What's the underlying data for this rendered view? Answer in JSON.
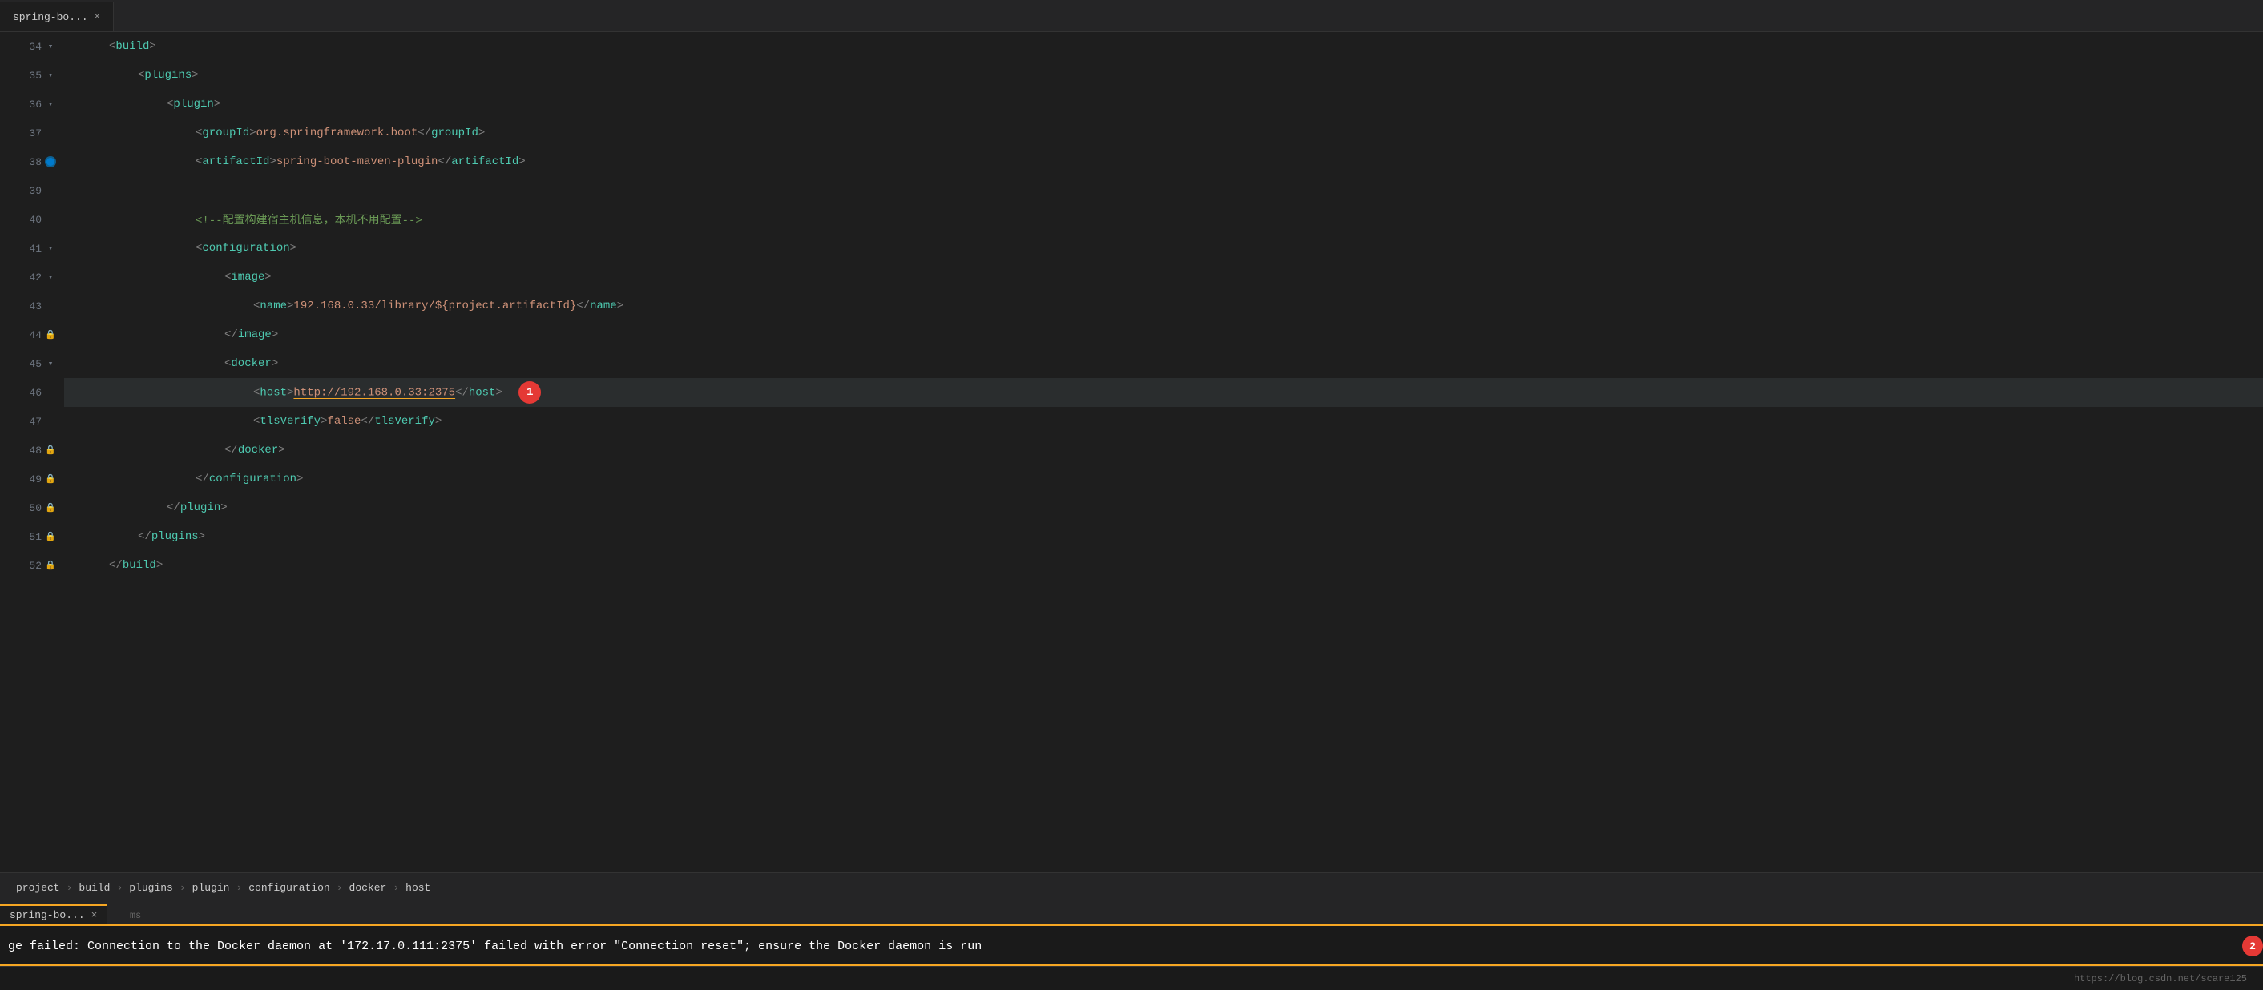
{
  "editor": {
    "title": "spring-bo...",
    "lines": [
      {
        "num": 34,
        "indent": 2,
        "hasFold": true,
        "content": "<build>",
        "type": "tag-line"
      },
      {
        "num": 35,
        "indent": 4,
        "hasFold": true,
        "content": "<plugins>",
        "type": "tag-line"
      },
      {
        "num": 36,
        "indent": 6,
        "hasFold": true,
        "content": "<plugin>",
        "type": "tag-line"
      },
      {
        "num": 37,
        "indent": 8,
        "hasFold": false,
        "content": "<groupId>org.springframework.boot</groupId>",
        "type": "tag-content"
      },
      {
        "num": 38,
        "indent": 8,
        "hasFold": false,
        "content": "<artifactId>spring-boot-maven-plugin</artifactId>",
        "type": "tag-content",
        "hasDebug": true
      },
      {
        "num": 39,
        "indent": 0,
        "hasFold": false,
        "content": "",
        "type": "empty"
      },
      {
        "num": 40,
        "indent": 8,
        "hasFold": false,
        "content": "<!--配置构建宿主机信息，本机不用配置-->",
        "type": "comment"
      },
      {
        "num": 41,
        "indent": 8,
        "hasFold": true,
        "content": "<configuration>",
        "type": "tag-line"
      },
      {
        "num": 42,
        "indent": 10,
        "hasFold": true,
        "content": "<image>",
        "type": "tag-line"
      },
      {
        "num": 43,
        "indent": 12,
        "hasFold": false,
        "content": "<name>192.168.0.33/library/${project.artifactId}</name>",
        "type": "tag-content"
      },
      {
        "num": 44,
        "indent": 10,
        "hasFold": false,
        "content": "</image>",
        "type": "close-tag"
      },
      {
        "num": 45,
        "indent": 10,
        "hasFold": true,
        "content": "<docker>",
        "type": "tag-line"
      },
      {
        "num": 46,
        "indent": 12,
        "hasFold": false,
        "content": "<host>http://192.168.0.33:2375</host>",
        "type": "tag-content",
        "highlight": true,
        "annotation": "1"
      },
      {
        "num": 47,
        "indent": 12,
        "hasFold": false,
        "content": "<tlsVerify>false</tlsVerify>",
        "type": "tag-content"
      },
      {
        "num": 48,
        "indent": 10,
        "hasFold": false,
        "content": "</docker>",
        "type": "close-tag"
      },
      {
        "num": 49,
        "indent": 8,
        "hasFold": false,
        "content": "</configuration>",
        "type": "close-tag"
      },
      {
        "num": 50,
        "indent": 6,
        "hasFold": false,
        "content": "</plugin>",
        "type": "close-tag"
      },
      {
        "num": 51,
        "indent": 4,
        "hasFold": false,
        "content": "</plugins>",
        "type": "close-tag"
      },
      {
        "num": 52,
        "indent": 2,
        "hasFold": false,
        "content": "</build>",
        "type": "close-tag",
        "partial": true
      }
    ]
  },
  "breadcrumb": {
    "items": [
      "project",
      "build",
      "plugins",
      "plugin",
      "configuration",
      "docker",
      "host"
    ]
  },
  "tab": {
    "label": "spring-bo...",
    "close": "×"
  },
  "error": {
    "text": "ge failed: Connection to the Docker daemon at '172.17.0.111:2375' failed with error \"Connection reset\"; ensure the Docker daemon is run",
    "annotation": "2",
    "prefix": "ms"
  },
  "statusbar": {
    "url": "https://blog.csdn.net/scare125"
  },
  "colors": {
    "tag": "#4ec9b0",
    "bracket": "#808080",
    "text": "#ce9178",
    "comment": "#6a9955",
    "annotation_red": "#e53935",
    "underline_orange": "#f5a623"
  }
}
